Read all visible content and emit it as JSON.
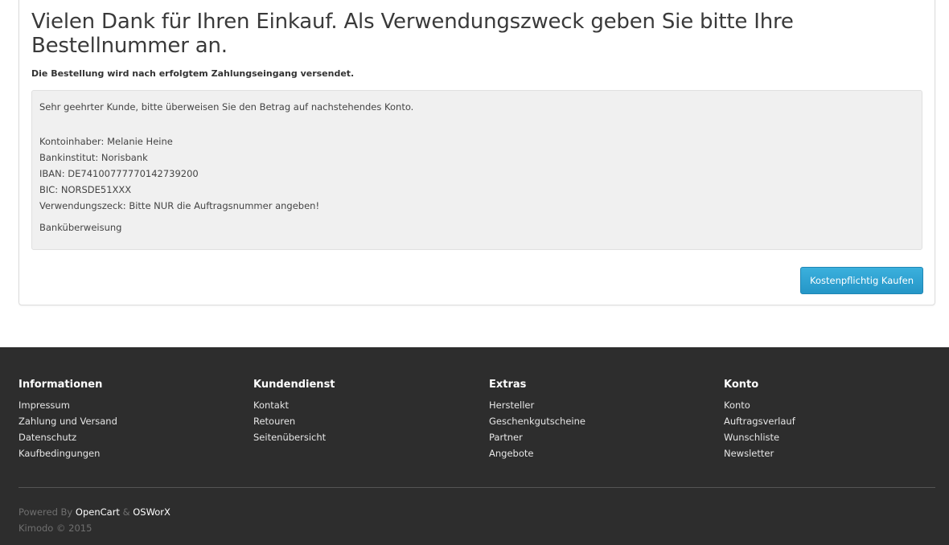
{
  "confirm": {
    "title": "Vielen Dank für Ihren Einkauf. Als Verwendungszweck geben Sie bitte Ihre Bestellnummer an.",
    "subtitle": "Die Bestellung wird nach erfolgtem Zahlungseingang versendet.",
    "intro": "Sehr geehrter Kunde, bitte überweisen Sie den Betrag auf nachstehendes Konto.",
    "details": [
      "Kontoinhaber: Melanie Heine",
      "Bankinstitut: Norisbank",
      "IBAN: DE74100777770142739200",
      "BIC: NORSDE51XXX",
      "Verwendungszeck: Bitte NUR die Auftragsnummer angeben!"
    ],
    "method": "Banküberweisung",
    "button_label": "Kostenpflichtig Kaufen"
  },
  "footer": {
    "columns": [
      {
        "heading": "Informationen",
        "links": [
          "Impressum",
          "Zahlung und Versand",
          "Datenschutz",
          "Kaufbedingungen"
        ]
      },
      {
        "heading": "Kundendienst",
        "links": [
          "Kontakt",
          "Retouren",
          "Seitenübersicht"
        ]
      },
      {
        "heading": "Extras",
        "links": [
          "Hersteller",
          "Geschenkgutscheine",
          "Partner",
          "Angebote"
        ]
      },
      {
        "heading": "Konto",
        "links": [
          "Konto",
          "Auftragsverlauf",
          "Wunschliste",
          "Newsletter"
        ]
      }
    ],
    "powered_prefix": "Powered By",
    "powered_link1": "OpenCart",
    "powered_amp": "&",
    "powered_link2": "OSWorX",
    "copyright": "Kimodo © 2015"
  },
  "colors": {
    "button": "#2fa4d5",
    "footer_bg": "#2d2d2d",
    "box_bg": "#f0f0f0"
  }
}
